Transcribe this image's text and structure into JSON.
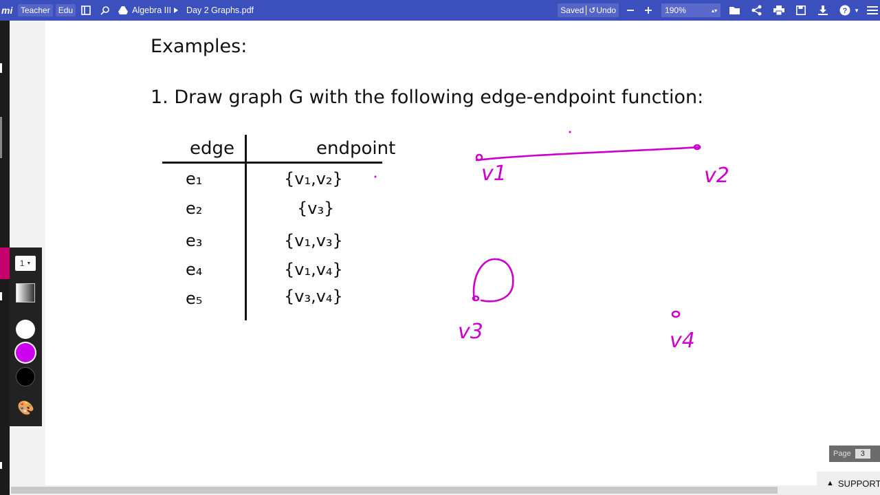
{
  "toolbar": {
    "logo": "mi",
    "chip_teacher": "Teacher",
    "chip_edu": "Edu",
    "drive_folder": "Algebra III",
    "file_name": "Day 2 Graphs.pdf",
    "saved": "Saved",
    "undo": "Undo",
    "zoom": "190%"
  },
  "document": {
    "heading": "Examples:",
    "prompt": "1. Draw graph G with the following edge-endpoint function:",
    "col_edge": "edge",
    "col_endpoint": "endpoint",
    "rows": [
      {
        "edge": "e₁",
        "endpoint": "{v₁,v₂}"
      },
      {
        "edge": "e₂",
        "endpoint": "{v₃}"
      },
      {
        "edge": "e₃",
        "endpoint": "{v₁,v₃}"
      },
      {
        "edge": "e₄",
        "endpoint": "{v₁,v₄}"
      },
      {
        "edge": "e₅",
        "endpoint": "{v₃,v₄}"
      }
    ]
  },
  "handwriting": {
    "v1": "v1",
    "v2": "v2",
    "v3": "v3",
    "v4": "v4",
    "ink_color": "#cc00cc"
  },
  "palette": {
    "pen_size": "1",
    "colors": [
      "#ffffff",
      "#cc00ee",
      "#000000"
    ],
    "selected": "#cc00ee"
  },
  "pager": {
    "label": "Page",
    "number": "3"
  },
  "support": "SUPPORT"
}
